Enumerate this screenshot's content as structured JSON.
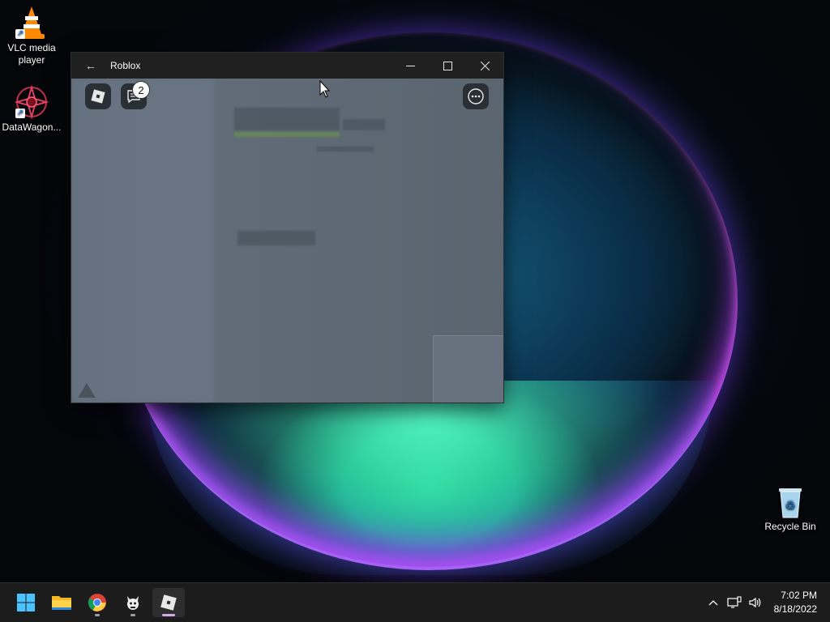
{
  "desktop": {
    "icons": [
      {
        "label": "VLC media player"
      },
      {
        "label": "DataWagon..."
      },
      {
        "label": "Recycle Bin"
      }
    ]
  },
  "window": {
    "title": "Roblox",
    "back_glyph": "←",
    "minimize_glyph": "—",
    "maximize_glyph": "☐",
    "close_glyph": "✕",
    "chat_badge": "2"
  },
  "taskbar": {
    "time": "7:02 PM",
    "date": "8/18/2022",
    "apps": [
      "start-icon",
      "file-explorer-icon",
      "chrome-icon",
      "gimp-icon",
      "roblox-icon"
    ]
  },
  "colors": {
    "accent": "#c05cff",
    "taskbar": "#1c1c1c",
    "titlebar": "#202020"
  }
}
